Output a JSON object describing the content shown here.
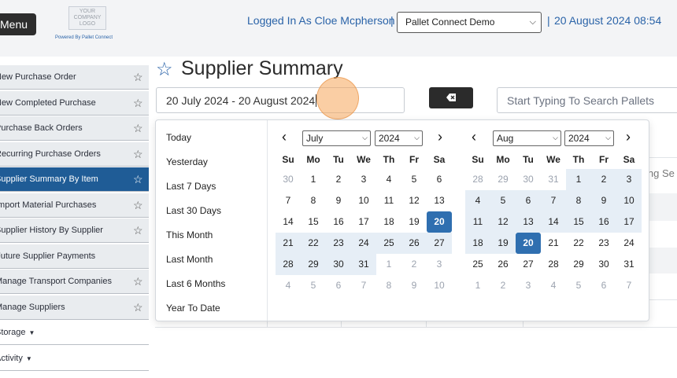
{
  "header": {
    "menu_label": "Menu",
    "logo_text": "YOUR COMPANY LOGO",
    "powered_by": "Powered By Pallet Connect",
    "logged_in": "Logged In As Cloe Mcpherson",
    "separator": "|",
    "company_select": "Pallet Connect Demo",
    "datetime": "20 August 2024 08:54"
  },
  "sidebar": {
    "items": [
      {
        "label": "New Purchase Order",
        "star": true
      },
      {
        "label": "New Completed Purchase",
        "star": true
      },
      {
        "label": "Purchase Back Orders",
        "star": true
      },
      {
        "label": "Recurring Purchase Orders",
        "star": true
      },
      {
        "label": "Supplier Summary By Item",
        "star": true,
        "active": true
      },
      {
        "label": "Import Material Purchases",
        "star": true
      },
      {
        "label": "Supplier History By Supplier",
        "star": true
      },
      {
        "label": "Future Supplier Payments",
        "star": false
      },
      {
        "label": "Manage Transport Companies",
        "star": true
      },
      {
        "label": "Manage Suppliers",
        "star": true
      },
      {
        "label": "Storage",
        "caret": true
      },
      {
        "label": "Activity",
        "caret": true
      }
    ]
  },
  "main": {
    "title": "Supplier Summary",
    "date_range_value": "20 July 2024 - 20 August 2024",
    "search_placeholder": "Start Typing To Search Pallets",
    "bg_text": "ing Se"
  },
  "picker": {
    "ranges": [
      "Today",
      "Yesterday",
      "Last 7 Days",
      "Last 30 Days",
      "This Month",
      "Last Month",
      "Last 6 Months",
      "Year To Date"
    ],
    "dow": [
      "Su",
      "Mo",
      "Tu",
      "We",
      "Th",
      "Fr",
      "Sa"
    ],
    "left": {
      "month": "July",
      "year": "2024",
      "weeks": [
        [
          "30",
          "1",
          "2",
          "3",
          "4",
          "5",
          "6"
        ],
        [
          "7",
          "8",
          "9",
          "10",
          "11",
          "12",
          "13"
        ],
        [
          "14",
          "15",
          "16",
          "17",
          "18",
          "19",
          "20"
        ],
        [
          "21",
          "22",
          "23",
          "24",
          "25",
          "26",
          "27"
        ],
        [
          "28",
          "29",
          "30",
          "31",
          "1",
          "2",
          "3"
        ],
        [
          "4",
          "5",
          "6",
          "7",
          "8",
          "9",
          "10"
        ]
      ]
    },
    "right": {
      "month": "Aug",
      "year": "2024",
      "weeks": [
        [
          "28",
          "29",
          "30",
          "31",
          "1",
          "2",
          "3"
        ],
        [
          "4",
          "5",
          "6",
          "7",
          "8",
          "9",
          "10"
        ],
        [
          "11",
          "12",
          "13",
          "14",
          "15",
          "16",
          "17"
        ],
        [
          "18",
          "19",
          "20",
          "21",
          "22",
          "23",
          "24"
        ],
        [
          "25",
          "26",
          "27",
          "28",
          "29",
          "30",
          "31"
        ],
        [
          "1",
          "2",
          "3",
          "4",
          "5",
          "6",
          "7"
        ]
      ]
    },
    "prev_icon": "chevron-left-icon",
    "next_icon": "chevron-right-icon",
    "accent_color": "#2f6fb0",
    "range_color": "#e6eef6"
  }
}
